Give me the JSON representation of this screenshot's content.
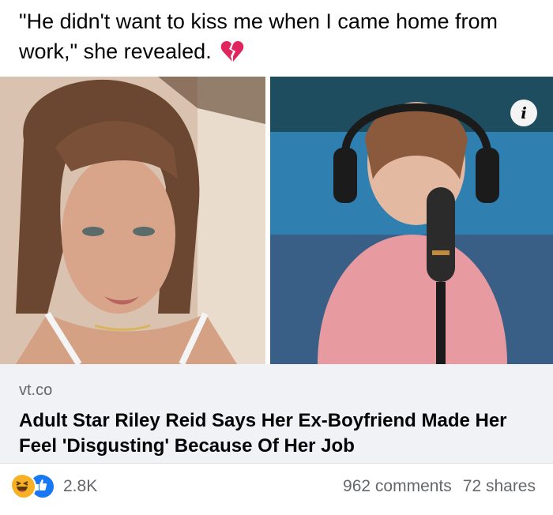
{
  "post": {
    "caption": "\"He didn't want to kiss me when I came home from work,\" she revealed."
  },
  "icons": {
    "heart": "broken-heart-icon",
    "info": "info-icon",
    "haha": "haha-reaction-icon",
    "like": "like-reaction-icon"
  },
  "link": {
    "domain": "vt.co",
    "title": "Adult Star Riley Reid Says Her Ex-Boyfriend Made Her Feel 'Disgusting' Because Of Her Job"
  },
  "info_glyph": "i",
  "engagement": {
    "reactions": "2.8K",
    "comments": "962 comments",
    "shares": "72 shares"
  },
  "colors": {
    "haha": "#f7b125",
    "like": "#1877f2",
    "heart": "#e0245e",
    "muted_text": "#65676b",
    "card_bg": "#f0f2f5"
  }
}
